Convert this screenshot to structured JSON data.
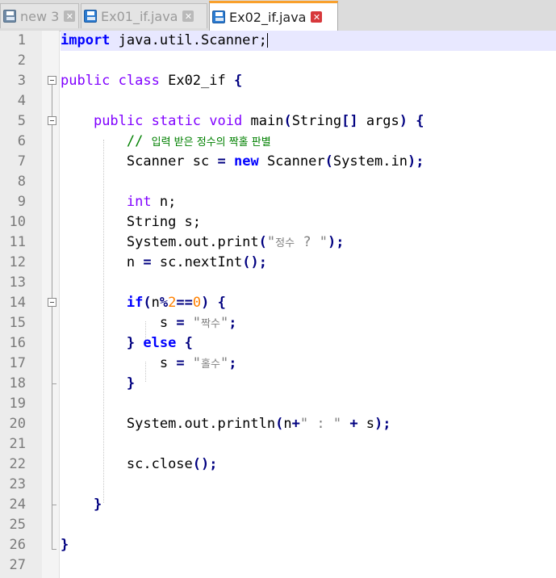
{
  "tabs": [
    {
      "label": "new 3",
      "active": false,
      "icon": "floppy-icon",
      "close": "close-icon"
    },
    {
      "label": "Ex01_if.java",
      "active": false,
      "icon": "floppy-icon",
      "close": "close-icon"
    },
    {
      "label": "Ex02_if.java",
      "active": true,
      "icon": "floppy-icon",
      "close": "close-icon"
    }
  ],
  "editor": {
    "line_numbers": [
      "1",
      "2",
      "3",
      "4",
      "5",
      "6",
      "7",
      "8",
      "9",
      "10",
      "11",
      "12",
      "13",
      "14",
      "15",
      "16",
      "17",
      "18",
      "19",
      "20",
      "21",
      "22",
      "23",
      "24",
      "25",
      "26",
      "27"
    ],
    "lines": {
      "l1_kw": "import",
      "l1_rest": " java.util.Scanner;",
      "l3_kw1": "public",
      "l3_kw2": "class",
      "l3_name": " Ex02_if ",
      "l3_brace": "{",
      "l5_kw1": "public",
      "l5_kw2": "static",
      "l5_kw3": "void",
      "l5_name": " main",
      "l5_p1": "(",
      "l5_type": "String",
      "l5_arr": "[]",
      "l5_args": " args",
      "l5_p2": ")",
      "l5_brace": " {",
      "l6_comment_prefix": "// ",
      "l6_comment": "입력 받은 정수의 짝홀 판별",
      "l7_a": "Scanner sc ",
      "l7_eq": "=",
      "l7_new": "new",
      "l7_b": " Scanner",
      "l7_p1": "(",
      "l7_c": "System.in",
      "l7_p2": ");",
      "l9_kw": "int",
      "l9_rest": " n;",
      "l10_text": "String s;",
      "l11_a": "System.out.print",
      "l11_p1": "(",
      "l11_s1": "\"",
      "l11_kor": "정수",
      "l11_s2": " ? \"",
      "l11_p2": ");",
      "l12_a": "n ",
      "l12_eq": "=",
      "l12_b": " sc.nextInt",
      "l12_p": "();",
      "l14_kw": "if",
      "l14_p1": "(",
      "l14_n": "n",
      "l14_op1": "%",
      "l14_num1": "2",
      "l14_op2": "==",
      "l14_num2": "0",
      "l14_p2": ")",
      "l14_brace": " {",
      "l15_a": "s ",
      "l15_eq": "=",
      "l15_s1": " \"",
      "l15_kor": "짝수",
      "l15_s2": "\"",
      "l15_semi": ";",
      "l16_b1": "}",
      "l16_else": "else",
      "l16_b2": "{",
      "l17_a": "s ",
      "l17_eq": "=",
      "l17_s1": " \"",
      "l17_kor": "홀수",
      "l17_s2": "\"",
      "l17_semi": ";",
      "l18_brace": "}",
      "l20_a": "System.out.println",
      "l20_p1": "(",
      "l20_n": "n",
      "l20_plus1": "+",
      "l20_str": "\" : \"",
      "l20_plus2": "+",
      "l20_s": " s",
      "l20_p2": ");",
      "l22_a": "sc.close",
      "l22_p": "();",
      "l24_brace": "}",
      "l26_brace": "}"
    }
  }
}
